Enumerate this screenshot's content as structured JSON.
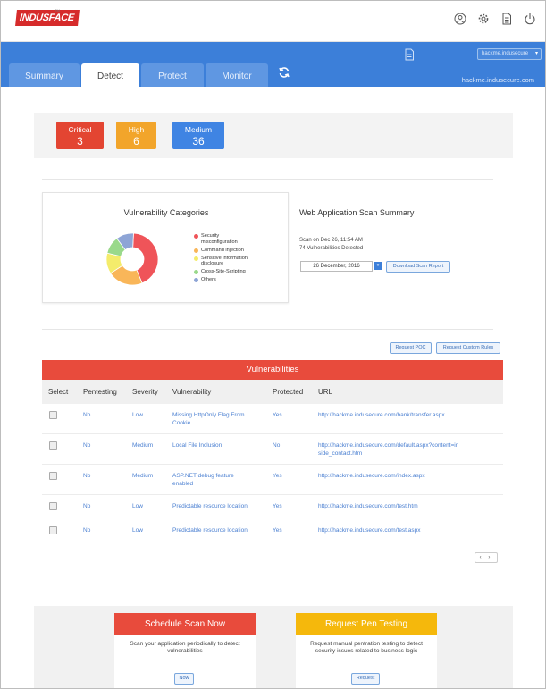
{
  "app": {
    "logo": "INDUSFACE",
    "logo_tm": "TM",
    "site_select": "hackme.indusecure",
    "host": "hackme.indusecure.com"
  },
  "tabs": [
    {
      "label": "Summary",
      "active": false
    },
    {
      "label": "Detect",
      "active": true
    },
    {
      "label": "Protect",
      "active": false
    },
    {
      "label": "Monitor",
      "active": false
    }
  ],
  "severity": {
    "critical": {
      "label": "Critical",
      "value": "3",
      "color": "#e34532"
    },
    "high": {
      "label": "High",
      "value": "6",
      "color": "#f2a52b"
    },
    "medium": {
      "label": "Medium",
      "value": "36",
      "color": "#3f84e3"
    }
  },
  "categories": {
    "title": "Vulnerability Categories",
    "chart_data": {
      "type": "pie",
      "categories": [
        "Security misconfiguration",
        "Command injection",
        "Sensitive information disclosure",
        "Cross-Site-Scripting",
        "Others"
      ],
      "values": [
        43,
        22,
        13,
        11,
        11
      ],
      "colors": [
        "#ef5459",
        "#f9b659",
        "#f4ec6b",
        "#9ad98b",
        "#8ea5d6"
      ]
    },
    "legend": [
      {
        "label": "Security misconfiguration",
        "color": "#ef5459"
      },
      {
        "label": "Command injection",
        "color": "#f9b659"
      },
      {
        "label": "Sensitive information disclosure",
        "color": "#f4ec6b"
      },
      {
        "label": "Cross-Site-Scripting",
        "color": "#9ad98b"
      },
      {
        "label": "Others",
        "color": "#8ea5d6"
      }
    ]
  },
  "scan_summary": {
    "title": "Web Application Scan Summary",
    "scan_on": "Scan on Dec 26, 11:54 AM",
    "detected": "74 Vulnerabilities Detected",
    "date_value": "26 December, 2016",
    "download_label": "Download Scan Report"
  },
  "actions": {
    "request_poc": "Request POC",
    "request_custom_rules": "Request Custom Rules"
  },
  "vulnerabilities": {
    "title": "Vulnerabilities",
    "columns": [
      "Select",
      "Pentesting",
      "Severity",
      "Vulnerability",
      "Protected",
      "URL"
    ],
    "rows": [
      {
        "pentesting": "No",
        "severity": "Low",
        "vulnerability": "Missing HttpOnly Flag From Cookie",
        "protected": "Yes",
        "url": "http://hackme.indusecure.com/bank/transfer.aspx"
      },
      {
        "pentesting": "No",
        "severity": "Medium",
        "vulnerability": "Local File Inclusion",
        "protected": "No",
        "url": "http://hackme.indusecure.com/default.aspx?content=inside_contact.htm"
      },
      {
        "pentesting": "No",
        "severity": "Medium",
        "vulnerability": "ASP.NET debug feature enabled",
        "protected": "Yes",
        "url": "http://hackme.indusecure.com/index.aspx"
      },
      {
        "pentesting": "No",
        "severity": "Low",
        "vulnerability": "Predictable resource location",
        "protected": "Yes",
        "url": "http://hackme.indusecure.com/test.htm"
      },
      {
        "pentesting": "No",
        "severity": "Low",
        "vulnerability": "Predictable resource location",
        "protected": "Yes",
        "url": "http://hackme.indusecure.com/test.aspx"
      }
    ],
    "pager": "‹ ›"
  },
  "cta": {
    "schedule": {
      "title": "Schedule Scan Now",
      "text": "Scan your application periodically to detect vulnerabilities",
      "button": "Now",
      "color": "#e84b3c"
    },
    "pen": {
      "title": "Request Pen Testing",
      "text": "Request manual pentration testing to detect security issues related to business logic",
      "button": "Request",
      "color": "#f5b80c"
    }
  }
}
